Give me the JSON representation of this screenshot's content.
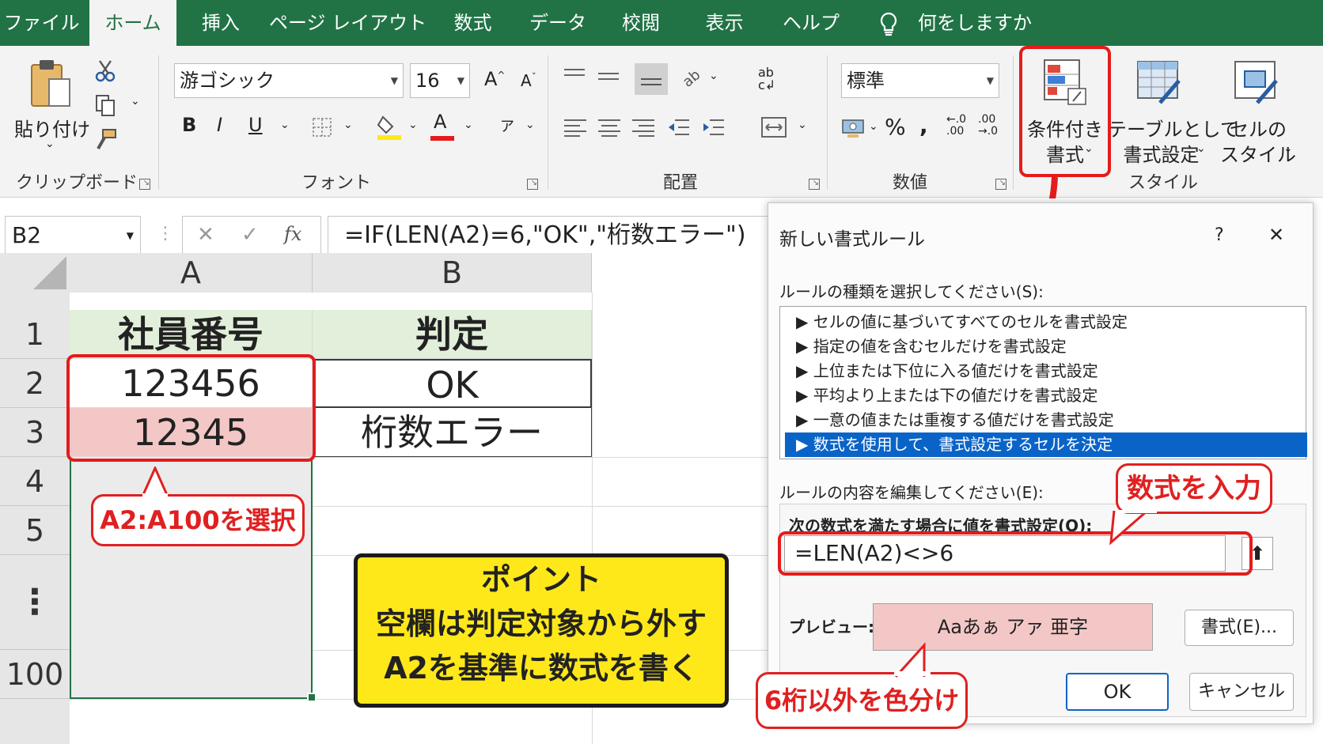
{
  "menu": {
    "tabs": [
      "ファイル",
      "ホーム",
      "挿入",
      "ページ レイアウト",
      "数式",
      "データ",
      "校閲",
      "表示",
      "ヘルプ"
    ],
    "active": "ホーム",
    "tell_me": "何をしますか"
  },
  "ribbon": {
    "clipboard": {
      "paste_label": "貼り付け",
      "group_label": "クリップボード"
    },
    "font": {
      "font_name": "游ゴシック",
      "font_size": "16",
      "bold": "B",
      "italic": "I",
      "underline": "U",
      "color_letter": "A",
      "group_label": "フォント"
    },
    "alignment": {
      "group_label": "配置"
    },
    "number": {
      "format": "標準",
      "percent": "%",
      "comma": ",",
      "group_label": "数値"
    },
    "styles": {
      "conditional": [
        "条件付き",
        "書式"
      ],
      "table": [
        "テーブルとして",
        "書式設定"
      ],
      "cell": [
        "セルの",
        "スタイル"
      ],
      "group_label": "スタイル"
    }
  },
  "formula_bar": {
    "name_box": "B2",
    "cancel": "✕",
    "enter": "✓",
    "fx": "fx",
    "formula": "=IF(LEN(A2)=6,\"OK\",\"桁数エラー\")"
  },
  "sheet": {
    "columns": [
      "A",
      "B"
    ],
    "rows": [
      "1",
      "2",
      "3",
      "4",
      "5",
      "⋮",
      "100"
    ],
    "cells": {
      "A1": "社員番号",
      "B1": "判定",
      "A2": "123456",
      "B2": "OK",
      "A3": "12345",
      "B3": "桁数エラー"
    }
  },
  "dialog": {
    "title": "新しい書式ルール",
    "help": "?",
    "close": "✕",
    "rule_type_label": "ルールの種類を選択してください(S):",
    "rules": [
      "セルの値に基づいてすべてのセルを書式設定",
      "指定の値を含むセルだけを書式設定",
      "上位または下位に入る値だけを書式設定",
      "平均より上または下の値だけを書式設定",
      "一意の値または重複する値だけを書式設定",
      "数式を使用して、書式設定するセルを決定"
    ],
    "selected_rule_index": 5,
    "edit_label": "ルールの内容を編集してください(E):",
    "formula_label": "次の数式を満たす場合に値を書式設定(O):",
    "formula_value": "=LEN(A2)<>6",
    "preview_label": "プレビュー:",
    "preview_text": "Aaあぁ アァ 亜字",
    "format_button": "書式(E)...",
    "ok": "OK",
    "cancel": "キャンセル"
  },
  "annotations": {
    "select_range": "A2:A100を選択",
    "enter_formula": "数式を入力",
    "color_code": "6桁以外を色分け",
    "point_title": "ポイント",
    "point_line1": "空欄は判定対象から外す",
    "point_line2": "A2を基準に数式を書く"
  },
  "colors": {
    "excel_green": "#217346",
    "header_fill": "#e2efda",
    "error_fill": "#f4c7c7",
    "highlight_red": "#e51b1b",
    "point_yellow": "#ffe81a",
    "selection_blue": "#0a64c8"
  }
}
